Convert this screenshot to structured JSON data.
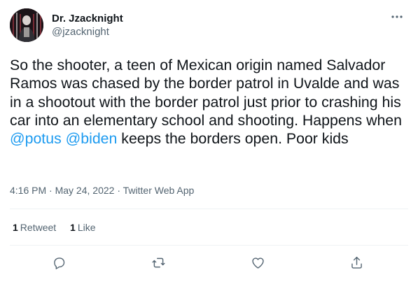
{
  "author": {
    "display_name": "Dr. Jzacknight",
    "handle": "@jzacknight"
  },
  "tweet": {
    "text_before": "So the shooter, a teen of Mexican origin named Salvador Ramos was chased by the border patrol in Uvalde and was in a shootout with the border patrol just prior to crashing his car into an elementary school and shooting. Happens when ",
    "mention_1": "@potus",
    "space": " ",
    "mention_2": "@biden",
    "text_after": " keeps the borders open. Poor kids",
    "time": "4:16 PM",
    "separator": " · ",
    "date": "May 24, 2022",
    "source": "Twitter Web App"
  },
  "stats": {
    "retweets_count": "1",
    "retweets_label": "Retweet",
    "likes_count": "1",
    "likes_label": "Like"
  },
  "colors": {
    "text": "#0f1419",
    "secondary": "#536471",
    "accent": "#1d9bf0",
    "divider": "#eff3f4"
  },
  "icons": {
    "more": "more-dots-icon",
    "reply": "reply-icon",
    "retweet": "retweet-icon",
    "like": "heart-icon",
    "share": "share-icon"
  }
}
